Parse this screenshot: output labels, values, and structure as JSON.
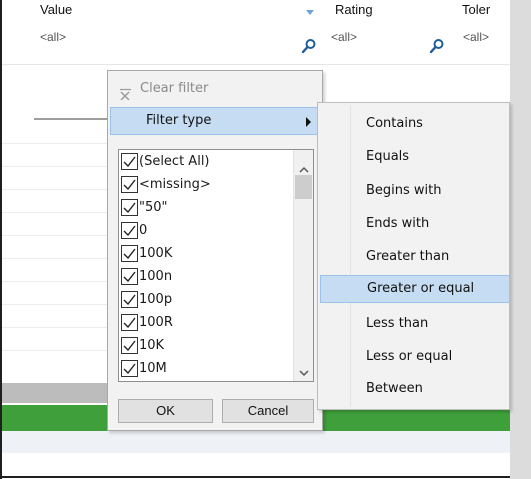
{
  "columns": [
    {
      "title": "Value",
      "filter": "<all>"
    },
    {
      "title": "Rating",
      "filter": "<all>"
    },
    {
      "title": "Toler",
      "filter": "<all>"
    }
  ],
  "popup": {
    "clear_filter": "Clear filter",
    "filter_type": "Filter type",
    "items": [
      "(Select All)",
      "<missing>",
      "\"50\"",
      "0",
      "100K",
      "100n",
      "100p",
      "100R",
      "10K",
      "10M"
    ],
    "ok": "OK",
    "cancel": "Cancel"
  },
  "submenu": {
    "items": [
      "Contains",
      "Equals",
      "Begins with",
      "Ends with",
      "Greater than",
      "Greater or equal",
      "Less than",
      "Less or equal",
      "Between"
    ],
    "highlighted": "Greater or equal"
  },
  "colors": {
    "highlight": "#c6dcf3",
    "green_band": "#3f9f3a",
    "sort_arrow": "#6aa4d8"
  }
}
